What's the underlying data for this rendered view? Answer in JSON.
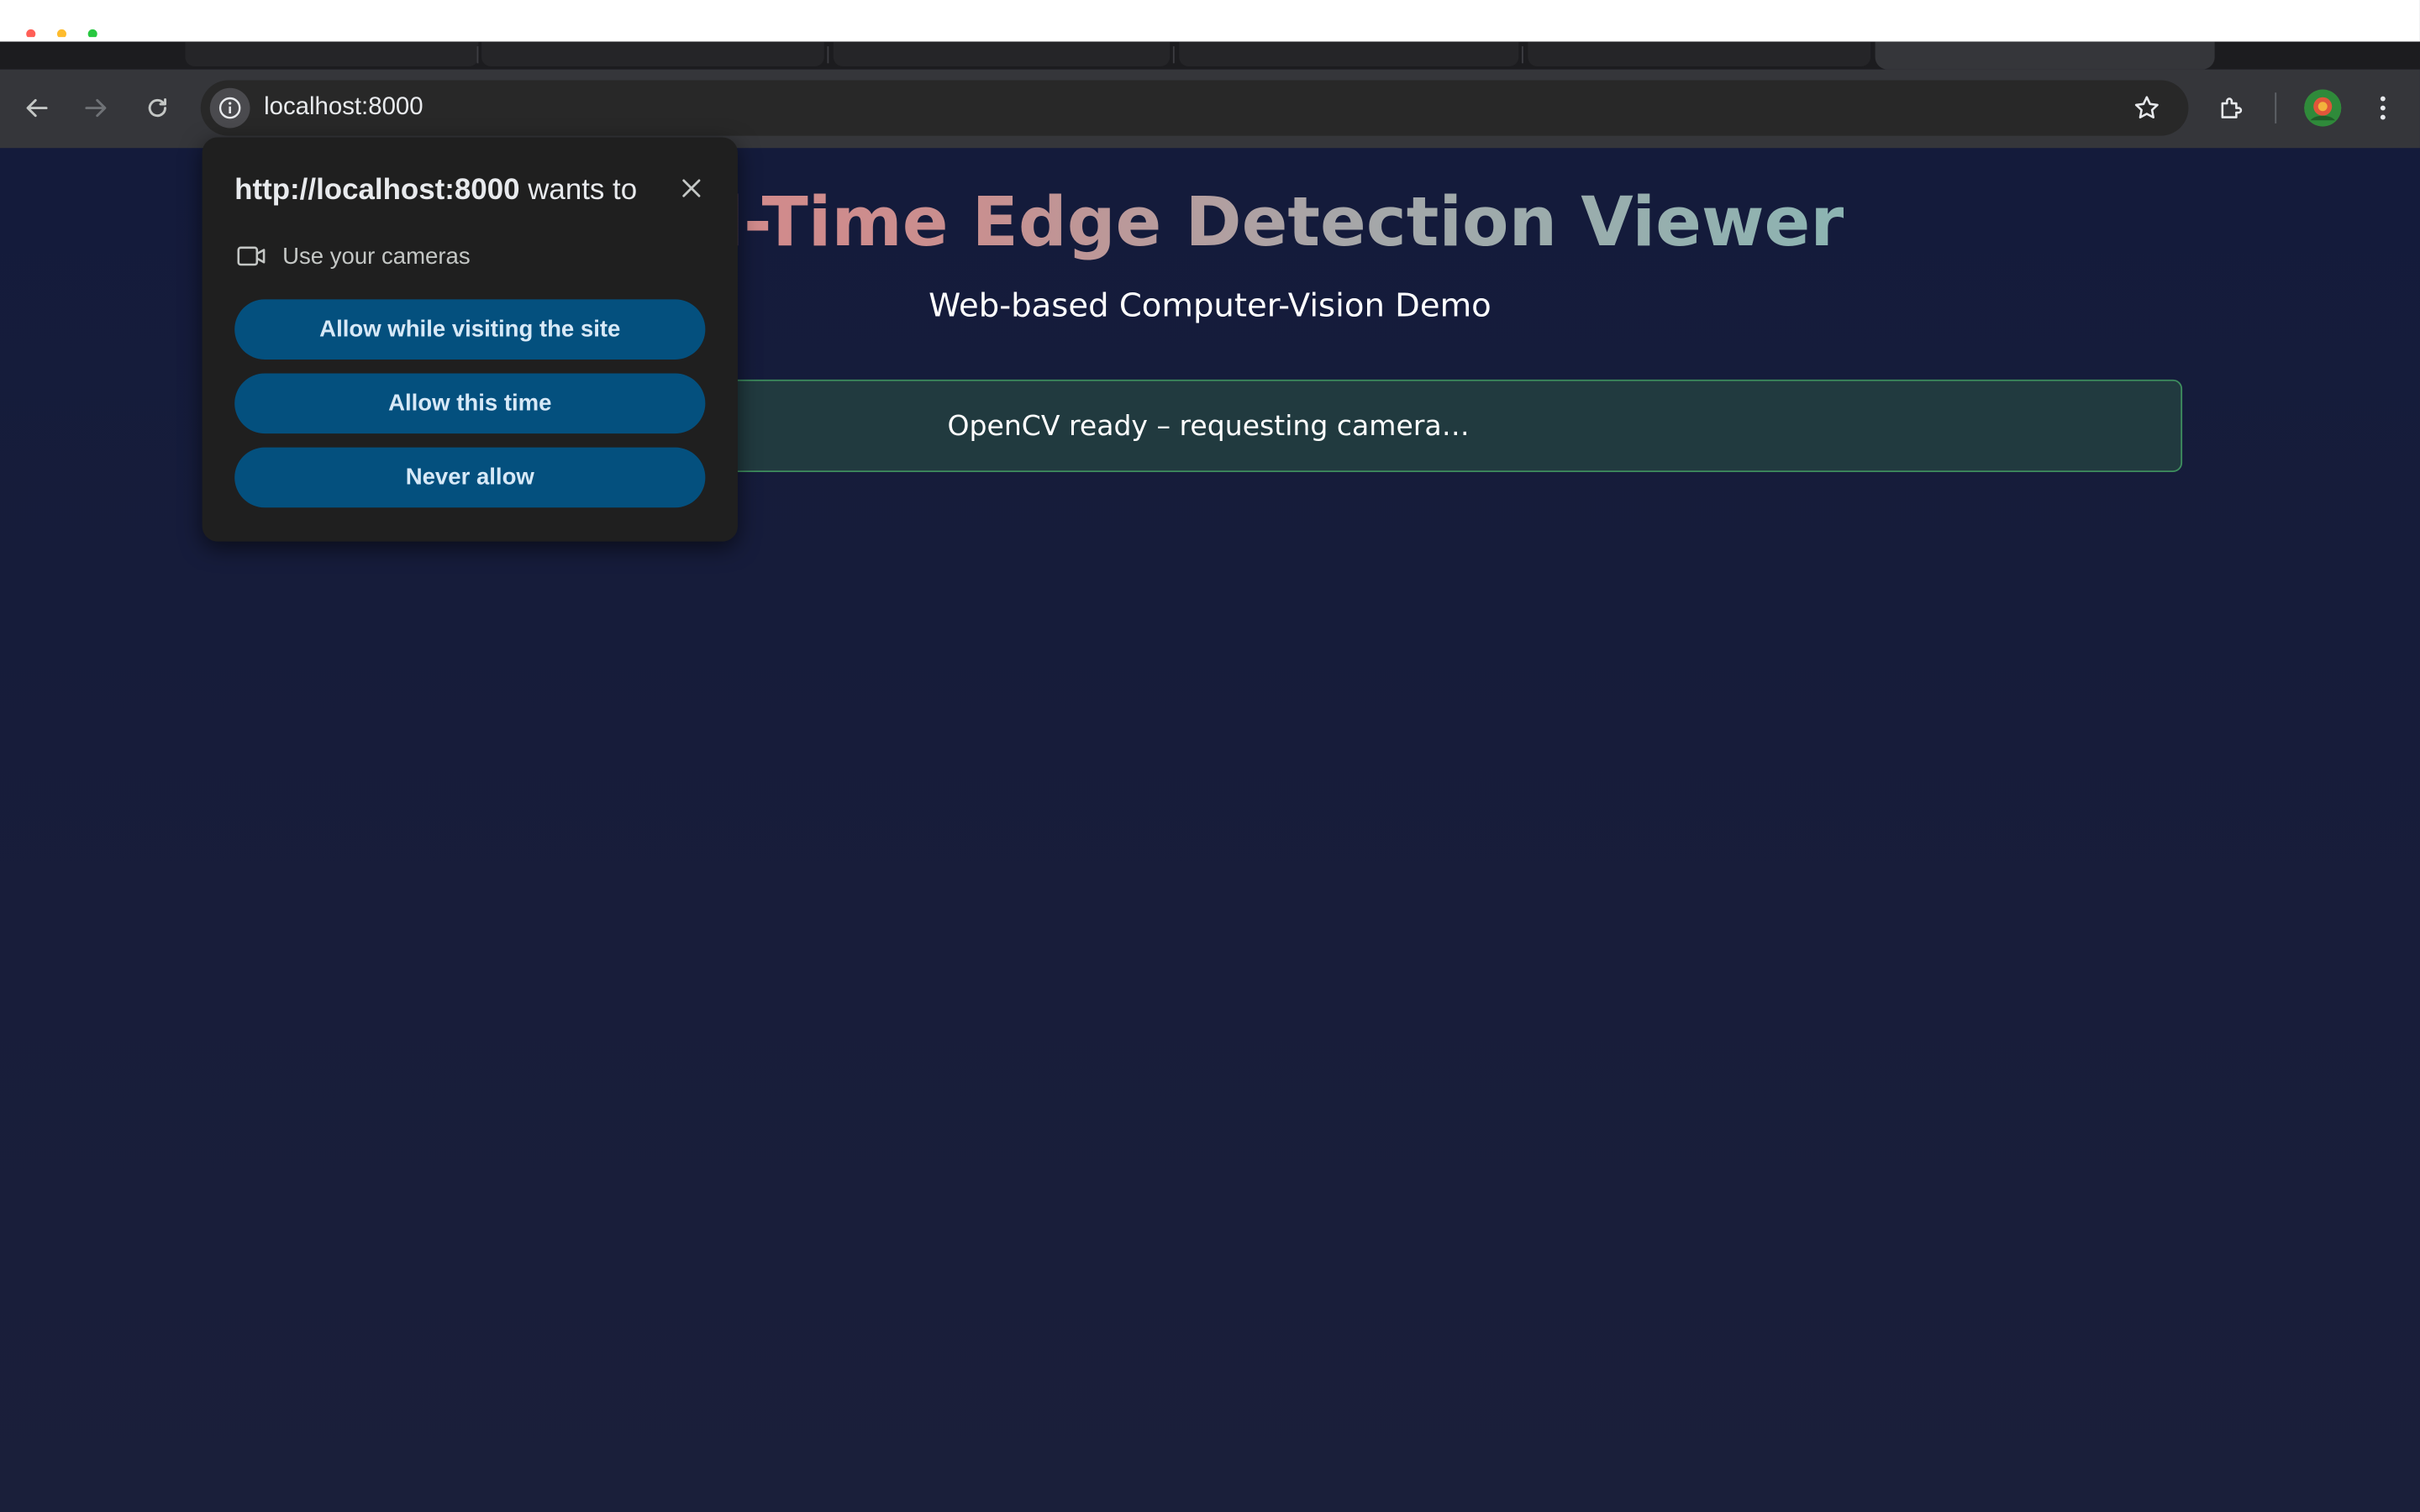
{
  "browser": {
    "url": "localhost:8000",
    "icons": {
      "back": "arrow-left-icon",
      "forward": "arrow-right-icon",
      "reload": "reload-icon",
      "site_info": "info-icon",
      "bookmark": "star-icon",
      "extensions": "puzzle-icon",
      "profile": "avatar",
      "menu": "kebab-menu-icon"
    }
  },
  "permission_prompt": {
    "origin": "http://localhost:8000",
    "title_suffix": " wants to",
    "permission_label": "Use your cameras",
    "permission_icon": "camera-icon",
    "buttons": {
      "allow_visiting": "Allow while visiting the site",
      "allow_once": "Allow this time",
      "never": "Never allow"
    },
    "close_icon": "close-icon"
  },
  "page": {
    "title": "Real-Time Edge Detection Viewer",
    "subtitle": "Web-based Computer-Vision Demo",
    "status": "OpenCV ready – requesting camera…"
  },
  "colors": {
    "page_bg": "#181d3a",
    "prompt_button": "#04507e",
    "status_border": "#3e8e5e",
    "title_gradient_start": "#f07b7f",
    "title_gradient_end": "#6ec4bd"
  }
}
